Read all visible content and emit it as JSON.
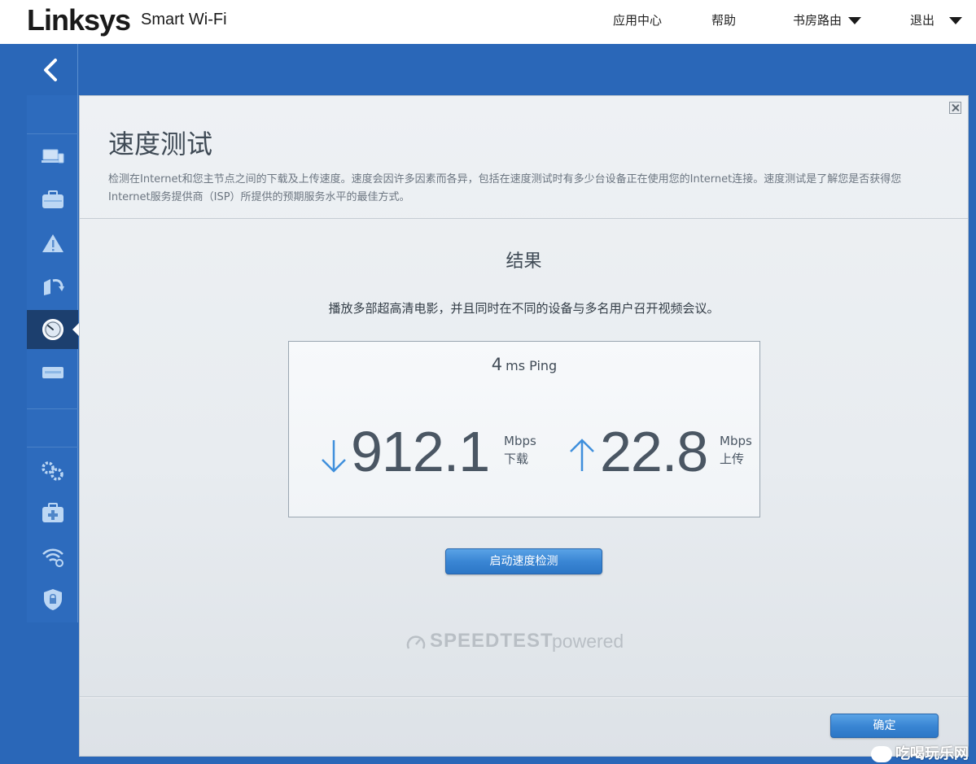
{
  "header": {
    "logo": "Linksys",
    "product": "Smart Wi-Fi",
    "nav": {
      "app_center": "应用中心",
      "help": "帮助",
      "router_name": "书房路由",
      "logout": "退出"
    }
  },
  "sidebar": {
    "items": [
      {
        "icon": "devices-icon",
        "active": false
      },
      {
        "icon": "toolbox-icon",
        "active": false
      },
      {
        "icon": "alert-icon",
        "active": false
      },
      {
        "icon": "media-prioritization-icon",
        "active": false
      },
      {
        "icon": "speedometer-icon",
        "active": true
      },
      {
        "icon": "usb-storage-icon",
        "active": false
      },
      {
        "icon": "settings-gears-icon",
        "active": false
      },
      {
        "icon": "troubleshooting-icon",
        "active": false
      },
      {
        "icon": "wireless-settings-icon",
        "active": false
      },
      {
        "icon": "security-shield-icon",
        "active": false
      }
    ]
  },
  "dialog": {
    "title": "速度测试",
    "description": "检测在Internet和您主节点之间的下载及上传速度。速度会因许多因素而各异，包括在速度测试时有多少台设备正在使用您的Internet连接。速度测试是了解您是否获得您Internet服务提供商（ISP）所提供的预期服务水平的最佳方式。",
    "results_title": "结果",
    "results_desc": "播放多部超高清电影，并且同时在不同的设备与多名用户召开视频会议。",
    "ping_value": "4",
    "ping_label": "ms Ping",
    "download_value": "912.1",
    "download_unit": "Mbps",
    "download_label": "下载",
    "upload_value": "22.8",
    "upload_unit": "Mbps",
    "upload_label": "上传",
    "run_button": "启动速度检测",
    "speedtest_word": "SPEEDTEST",
    "speedtest_powered": "powered",
    "ok_button": "确定"
  },
  "watermark": "吃喝玩乐网",
  "colors": {
    "background": "#2a67b8",
    "button": "#3a86d4",
    "arrow": "#3f8fdc"
  }
}
